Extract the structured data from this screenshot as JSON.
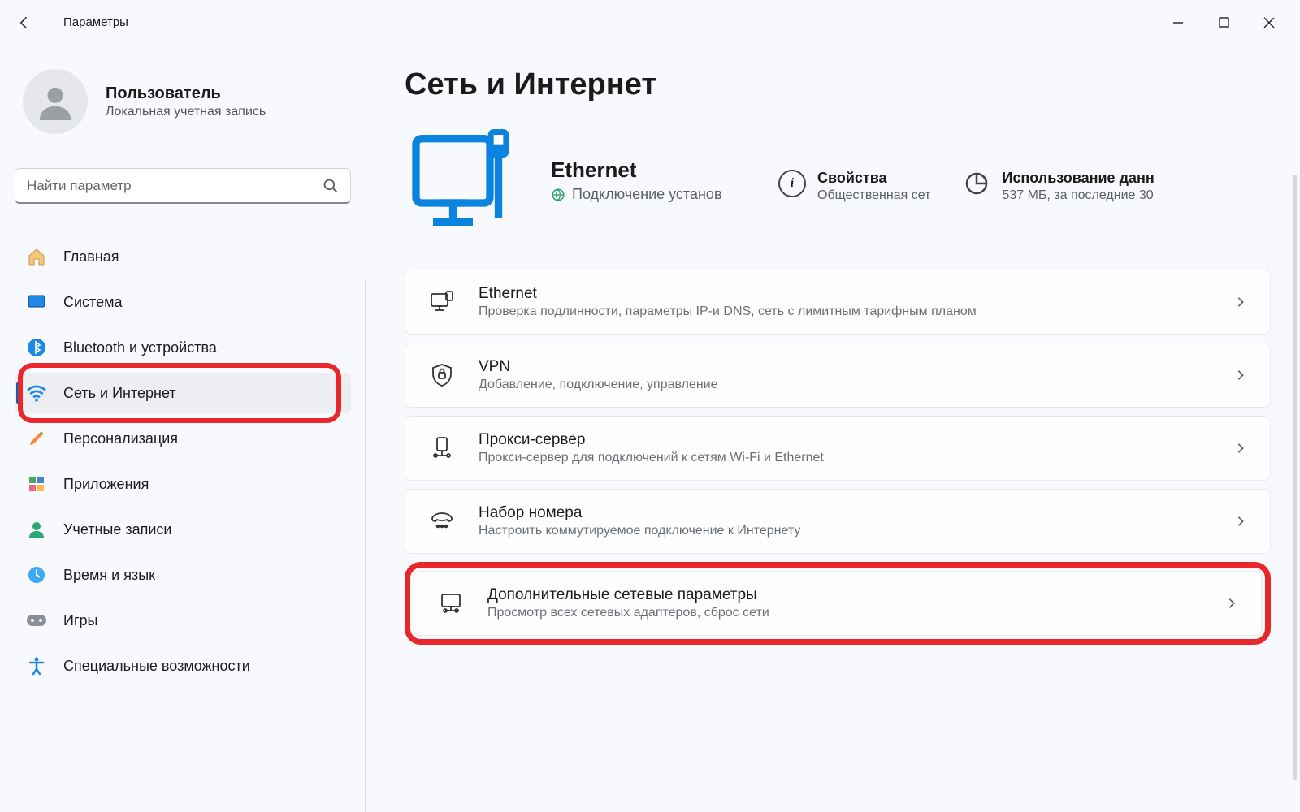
{
  "app_title": "Параметры",
  "user": {
    "name": "Пользователь",
    "subtitle": "Локальная учетная запись"
  },
  "search": {
    "placeholder": "Найти параметр"
  },
  "nav": {
    "items": [
      {
        "id": "home",
        "label": "Главная"
      },
      {
        "id": "system",
        "label": "Система"
      },
      {
        "id": "bluetooth",
        "label": "Bluetooth и устройства"
      },
      {
        "id": "network",
        "label": "Сеть и Интернет",
        "active": true,
        "highlighted": true
      },
      {
        "id": "personalize",
        "label": "Персонализация"
      },
      {
        "id": "apps",
        "label": "Приложения"
      },
      {
        "id": "accounts",
        "label": "Учетные записи"
      },
      {
        "id": "time",
        "label": "Время и язык"
      },
      {
        "id": "gaming",
        "label": "Игры"
      },
      {
        "id": "accessibility",
        "label": "Специальные возможности"
      }
    ]
  },
  "page": {
    "title": "Сеть и Интернет",
    "status": {
      "name": "Ethernet",
      "connection": "Подключение установ"
    },
    "properties": {
      "title": "Свойства",
      "sub": "Общественная сет"
    },
    "usage": {
      "title": "Использование данн",
      "sub": "537 МБ, за последние 30"
    },
    "cards": [
      {
        "id": "ethernet",
        "title": "Ethernet",
        "desc": "Проверка подлинности, параметры IP-и DNS, сеть с лимитным тарифным планом"
      },
      {
        "id": "vpn",
        "title": "VPN",
        "desc": "Добавление, подключение, управление"
      },
      {
        "id": "proxy",
        "title": "Прокси-сервер",
        "desc": "Прокси-сервер для подключений к сетям Wi-Fi и Ethernet"
      },
      {
        "id": "dialup",
        "title": "Набор номера",
        "desc": "Настроить коммутируемое подключение к Интернету"
      },
      {
        "id": "advanced",
        "title": "Дополнительные сетевые параметры",
        "desc": "Просмотр всех сетевых адаптеров, сброс сети",
        "highlighted": true
      }
    ]
  }
}
